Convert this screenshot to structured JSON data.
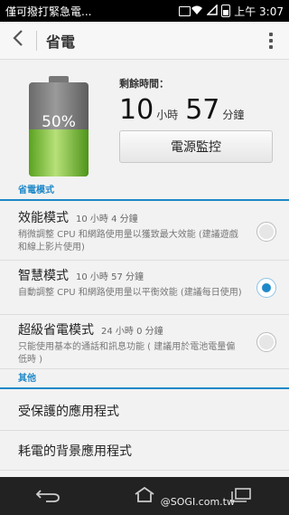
{
  "status_bar": {
    "notification": "僅可撥打緊急電...",
    "time": "上午 3:07"
  },
  "action_bar": {
    "title": "省電"
  },
  "summary": {
    "battery_percent_text": "50%",
    "battery_level": 0.5,
    "remaining_label": "剩餘時間：",
    "hours": "10",
    "hours_unit": "小時",
    "minutes": "57",
    "minutes_unit": "分鐘",
    "monitor_button": "電源監控"
  },
  "power_saving": {
    "header": "省電模式",
    "modes": [
      {
        "title": "效能模式",
        "duration": "10 小時 4 分鐘",
        "description": "稍微調整 CPU 和網路使用量以獲致最大效能 (建議遊戲和線上影片使用)",
        "selected": false
      },
      {
        "title": "智慧模式",
        "duration": "10 小時 57 分鐘",
        "description": "自動調整 CPU 和網路使用量以平衡效能 (建議每日使用)",
        "selected": true
      },
      {
        "title": "超級省電模式",
        "duration": "24 小時 0 分鐘",
        "description": "只能使用基本的通話和訊息功能 ( 建議用於電池電量偏低時 )",
        "selected": false
      }
    ]
  },
  "other": {
    "header": "其他",
    "items": [
      "受保護的應用程式",
      "耗電的背景應用程式"
    ]
  },
  "nav": {
    "watermark": "@SOGI.com.tw"
  },
  "colors": {
    "accent": "#1e88c8",
    "battery_green": "#8cc94a"
  }
}
